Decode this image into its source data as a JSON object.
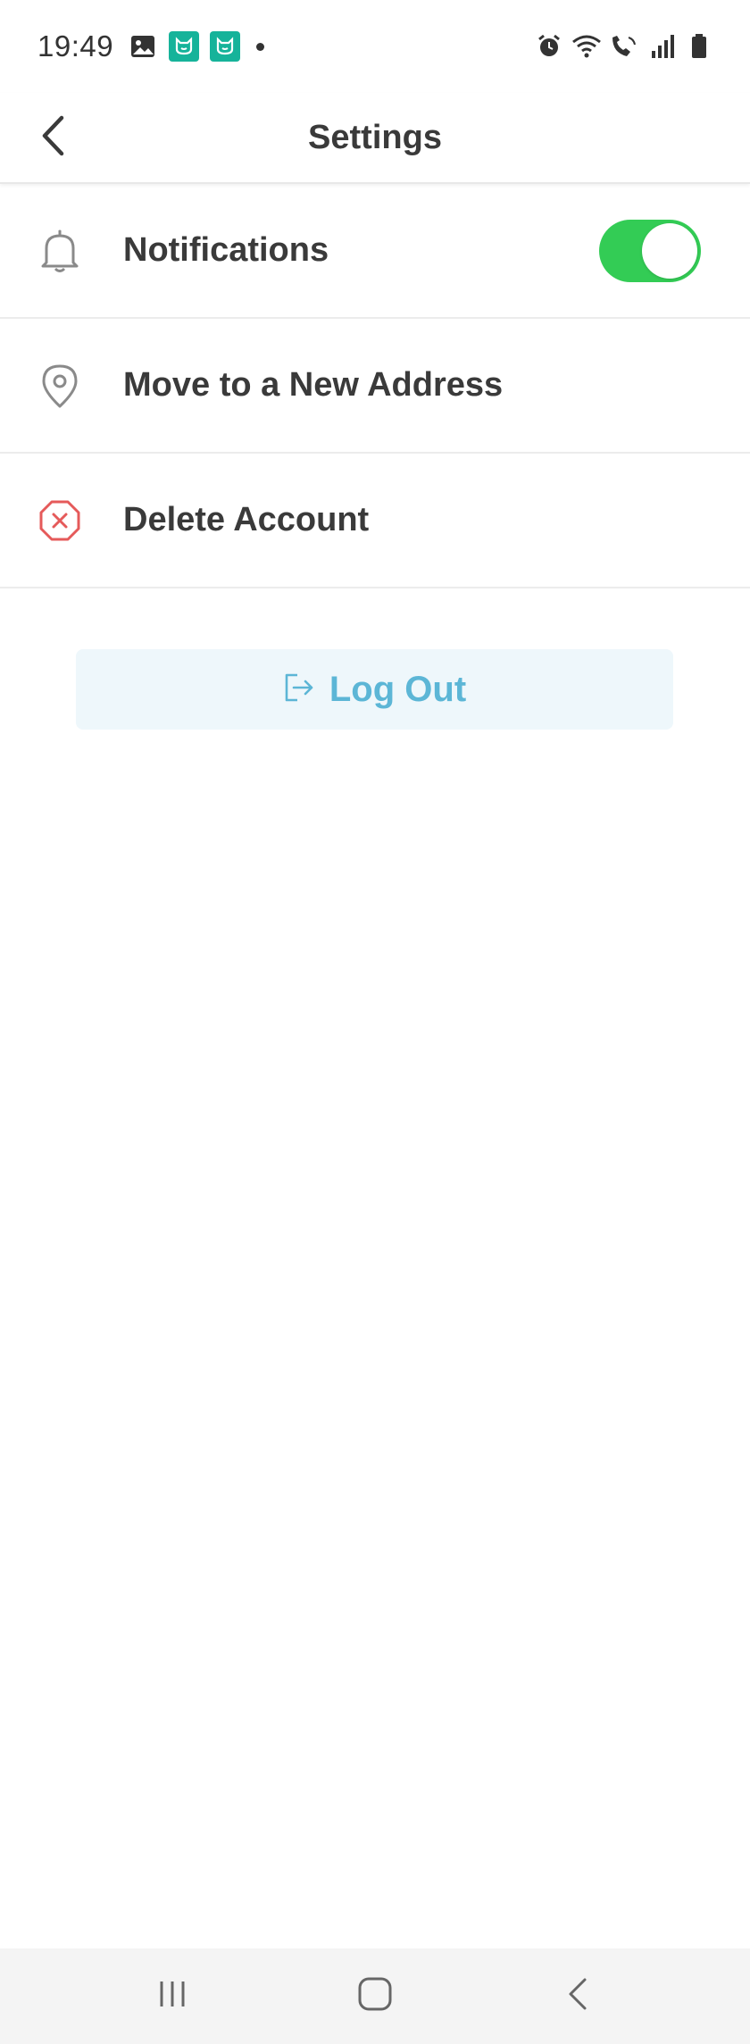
{
  "status_bar": {
    "time": "19:49",
    "left_icons": [
      "gallery-icon",
      "app-badge-icon",
      "app-badge-icon",
      "dot-icon"
    ],
    "right_icons": [
      "alarm-icon",
      "wifi-icon",
      "call-signal-icon",
      "cell-signal-icon",
      "battery-icon"
    ]
  },
  "header": {
    "title": "Settings",
    "back_icon": "chevron-left-icon"
  },
  "settings": {
    "items": [
      {
        "label": "Notifications",
        "icon": "bell-icon",
        "toggle": true
      },
      {
        "label": "Move to a New Address",
        "icon": "location-pin-icon"
      },
      {
        "label": "Delete Account",
        "icon": "close-octagon-icon"
      }
    ]
  },
  "logout": {
    "label": "Log Out",
    "icon": "logout-icon"
  },
  "colors": {
    "toggle_on": "#33cc55",
    "logout_text": "#5cb6d6",
    "logout_bg": "#eef7fb",
    "delete_icon": "#e55a5a",
    "app_badge": "#16b39a"
  },
  "nav_bar": {
    "buttons": [
      "recents-icon",
      "home-icon",
      "back-icon"
    ]
  }
}
